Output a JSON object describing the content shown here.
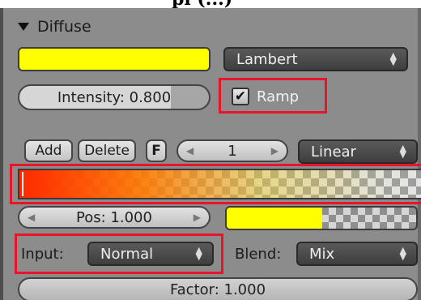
{
  "header": {
    "caption_text": "pl (...)",
    "title": "Diffuse"
  },
  "diffuse": {
    "color": "#ffff00",
    "shader": "Lambert",
    "intensity_label": "Intensity: 0.800",
    "intensity_value": 0.8,
    "ramp_label": "Ramp",
    "ramp_checked": true
  },
  "ramp_toolbar": {
    "add": "Add",
    "delete": "Delete",
    "flip": "F",
    "active_index": "1",
    "interpolation": "Linear"
  },
  "ramp": {
    "pos_label": "Pos: 1.000",
    "stop_color": "#ffff00"
  },
  "ramp_settings": {
    "input_label": "Input:",
    "input_value": "Normal",
    "blend_label": "Blend:",
    "blend_value": "Mix",
    "factor_label": "Factor: 1.000"
  },
  "colors": {
    "highlight": "#e8152a",
    "panel_bg": "#8c8c8c",
    "dropdown_bg": "#4a4a4a"
  },
  "icons": [
    "triangle-down-icon",
    "updown-icon",
    "checkmark-icon",
    "arrow-left-icon",
    "arrow-right-icon"
  ]
}
